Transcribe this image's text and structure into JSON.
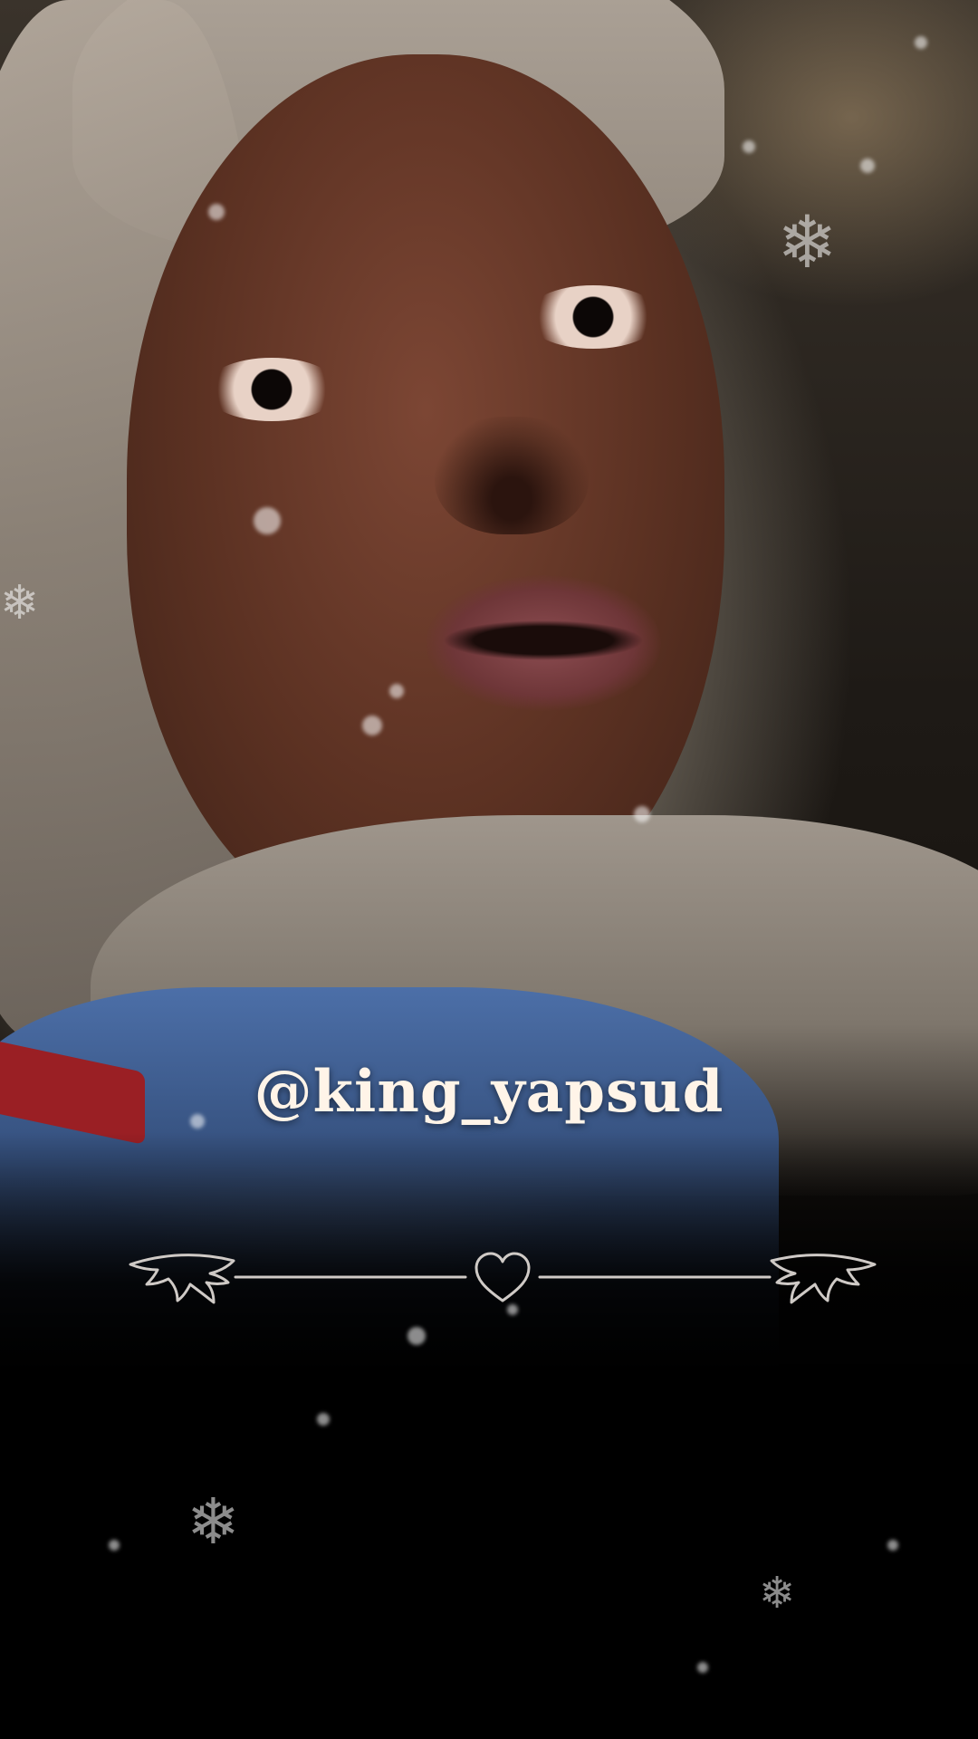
{
  "overlay": {
    "username": "@king_yapsud"
  },
  "icons": {
    "divider_center": "heart-icon",
    "divider_left": "wing-icon",
    "divider_right": "wing-icon",
    "particles": "snowflake-icon"
  },
  "colors": {
    "username_text": "#fff4e8",
    "divider_stroke": "#cfcac6"
  }
}
